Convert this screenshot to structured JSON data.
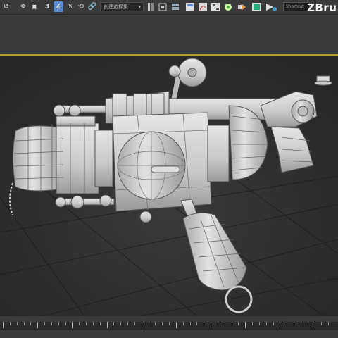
{
  "toolbar": {
    "left_glyph": "↺",
    "move_glyph": "✥",
    "select_glyph": "▣",
    "snap_label": "3",
    "angle_snap_label": "∡",
    "percent_snap_label": "%",
    "spinner_snap_glyph": "⟲",
    "link_glyph": "🔗",
    "selection_set_value": "创建选择集",
    "icons": [
      "mirror-icon",
      "align-icon",
      "layer-icon",
      "scene-explorer-icon",
      "curve-editor-icon",
      "schematic-icon",
      "material-editor-icon",
      "render-setup-icon",
      "render-frame-icon",
      "render-icon"
    ],
    "search_placeholder": "Shortcut"
  },
  "watermark": "ZBru",
  "viewport": {
    "background": "#2f2f2f",
    "border_color": "#b99a3a",
    "model": "blaster-wireframe-model"
  },
  "timeline": {
    "tick_count": 48
  }
}
